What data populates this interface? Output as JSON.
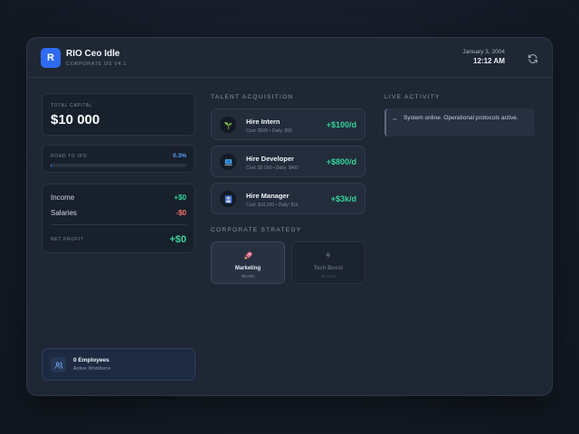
{
  "app": {
    "logo_letter": "R",
    "title": "RIO Ceo Idle",
    "subtitle": "CORPORATE OS V4.1",
    "date": "January 3, 2004",
    "time": "12:12 AM",
    "refresh_icon": "refresh-icon"
  },
  "stats": {
    "capital_label": "TOTAL CAPITAL",
    "capital_value": "$10 000",
    "ipo_label": "ROAD TO IPO",
    "ipo_percent": "0.3%",
    "ipo_progress": 0.003,
    "income_label": "Income",
    "income_value": "+$0",
    "salaries_label": "Salaries",
    "salaries_value": "-$0",
    "net_label": "NET PROFIT",
    "net_value": "+$0"
  },
  "employees": {
    "icon": "users-icon",
    "count_label": "0 Employees",
    "sub_label": "Active Workforce"
  },
  "talent": {
    "section_title": "TALENT ACQUISITION",
    "items": [
      {
        "icon": "sprout-icon",
        "title": "Hire Intern",
        "cost": "Cost: $500 • Daily: $50",
        "rate": "+$100/d"
      },
      {
        "icon": "laptop-icon",
        "title": "Hire Developer",
        "cost": "Cost: $5 000 • Daily: $400",
        "rate": "+$800/d"
      },
      {
        "icon": "manager-icon",
        "title": "Hire Manager",
        "cost": "Cost: $10,000 • Daily: $1k",
        "rate": "+$3k/d"
      }
    ]
  },
  "strategy": {
    "section_title": "CORPORATE STRATEGY",
    "items": [
      {
        "icon": "rocket-icon",
        "name": "Marketing",
        "cost": "$5,000"
      },
      {
        "icon": "lightning-icon",
        "name": "Tech Boost",
        "cost": "$10,000"
      }
    ]
  },
  "activity": {
    "section_title": "LIVE ACTIVITY",
    "items": [
      {
        "marker": "●●",
        "text": "System online. Operational protocols active."
      }
    ]
  }
}
